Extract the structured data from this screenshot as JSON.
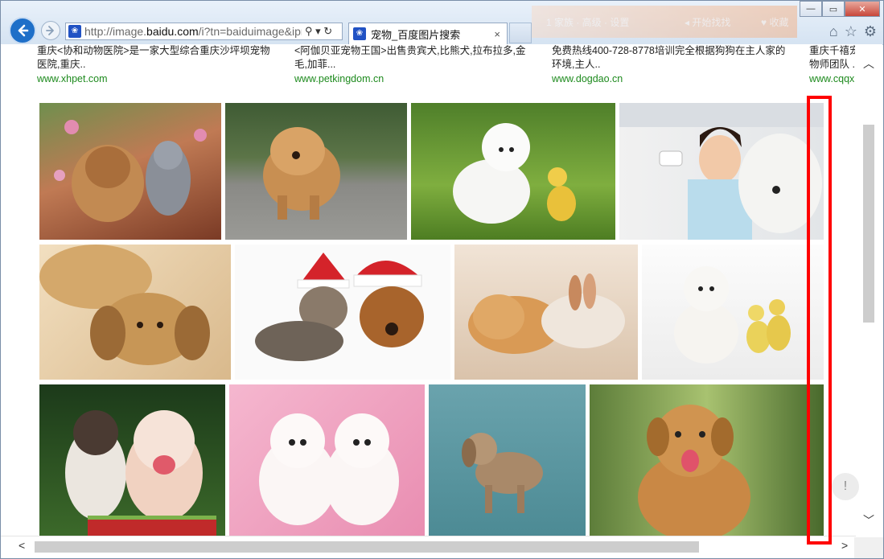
{
  "browser": {
    "url_plain_prefix": "http://image.",
    "url_domain": "baidu.com",
    "url_rest": "/i?tn=baiduimage&ipn",
    "tab_title": "宠物_百度图片搜索",
    "tab_close": "×",
    "favicon_glyph": "❀",
    "address_controls": "⚲ ▾ ↻",
    "bg_ghost_1": "1 家族 · 高级 · 设置",
    "bg_ghost_2": "◂ 开始找找",
    "bg_ghost_3": "♥ 收藏",
    "window_controls": {
      "minimize": "—",
      "restore": "▭",
      "close": "✕"
    },
    "toolbar_icons": {
      "home": "⌂",
      "favorites": "☆",
      "settings": "⚙"
    }
  },
  "results": [
    {
      "title": "重庆<协和动物医院>是一家大型综合重庆沙坪坝宠物医院,重庆..",
      "url": "www.xhpet.com"
    },
    {
      "title": "<阿伽贝亚宠物王国>出售贵宾犬,比熊犬,拉布拉多,金毛,加菲...",
      "url": "www.petkingdom.cn"
    },
    {
      "title": "免费热线400-728-8778培训完全根据狗狗在主人家的环境,主人..",
      "url": "www.dogdao.cn"
    },
    {
      "title": "重庆千禧宠物师团队 ..",
      "url": "www.cqqxpe"
    }
  ],
  "images": [
    {
      "alt": "puppy-and-kitten"
    },
    {
      "alt": "chow-chow-puppy"
    },
    {
      "alt": "white-puppy-and-duckling"
    },
    {
      "alt": "woman-with-sheepdog"
    },
    {
      "alt": "sleepy-puppies"
    },
    {
      "alt": "cat-and-dog-santa-hats"
    },
    {
      "alt": "puppy-and-bunny"
    },
    {
      "alt": "white-puppy-with-ducklings"
    },
    {
      "alt": "kitten-and-bulldog"
    },
    {
      "alt": "two-white-puppies-pink"
    },
    {
      "alt": "dachshund-puppy"
    },
    {
      "alt": "happy-brown-puppy"
    }
  ],
  "scroll": {
    "up": "︿",
    "down": "﹀",
    "left": "<",
    "right": ">"
  },
  "feedback_glyph": "!",
  "colors": {
    "accent": "#1e6fc8",
    "link_green": "#1d8a1d",
    "highlight": "#ff0000"
  }
}
